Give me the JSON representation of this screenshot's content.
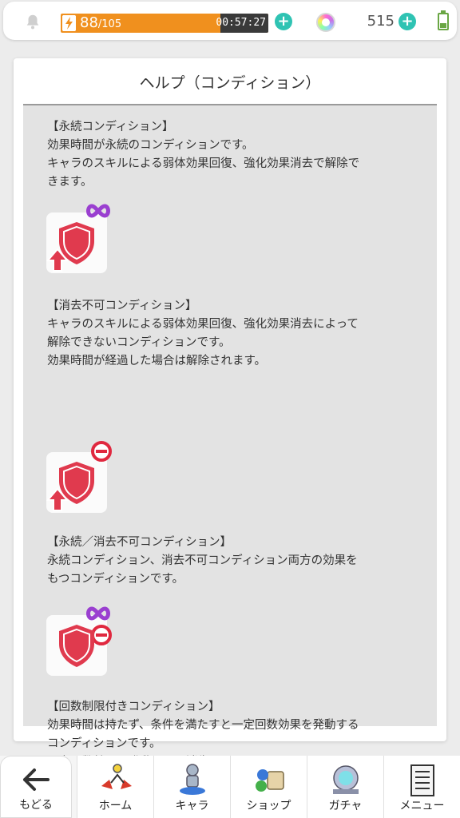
{
  "status_bar": {
    "stamina_current": "88",
    "stamina_max": "/105",
    "stamina_fraction": 0.838,
    "timer": "00:57:27",
    "gem_count": "515",
    "icons": [
      "bell-icon",
      "bolt-icon",
      "plus-icon",
      "gem-icon",
      "plus-icon",
      "battery-icon"
    ]
  },
  "help": {
    "title": "ヘルプ（コンディション）",
    "sections": [
      {
        "heading": "【永続コンディション】",
        "body": "効果時間が永続のコンディションです。\nキャラのスキルによる弱体効果回復、強化効果消去で解除で\nきます。",
        "icon": "permanent-condition-icon"
      },
      {
        "heading": "【消去不可コンディション】",
        "body": "キャラのスキルによる弱体効果回復、強化効果消去によって\n解除できないコンディションです。\n効果時間が経過した場合は解除されます。",
        "icon": "unremovable-condition-icon"
      },
      {
        "heading": "【永続／消去不可コンディション】",
        "body": "永続コンディション、消去不可コンディション両方の効果を\nもつコンディションです。",
        "icon": "permanent-unremovable-condition-icon"
      },
      {
        "heading": "【回数制限付きコンディション】",
        "body": "効果時間は持たず、条件を満たすと一定回数効果を発動する\nコンディションです。\n一定回数効果を発動すると消失します。"
      }
    ]
  },
  "colors": {
    "accent_teal": "#2fc3b3",
    "stamina_orange": "#f0901e",
    "shield_red": "#e03a4e",
    "infinity_purple": "#9a3fd0"
  },
  "nav": {
    "back_label": "もどる",
    "items": [
      {
        "label": "ホーム",
        "icon": "home-icon"
      },
      {
        "label": "キャラ",
        "icon": "character-icon"
      },
      {
        "label": "ショップ",
        "icon": "shop-icon"
      },
      {
        "label": "ガチャ",
        "icon": "gacha-icon"
      },
      {
        "label": "メニュー",
        "icon": "menu-icon"
      }
    ]
  }
}
